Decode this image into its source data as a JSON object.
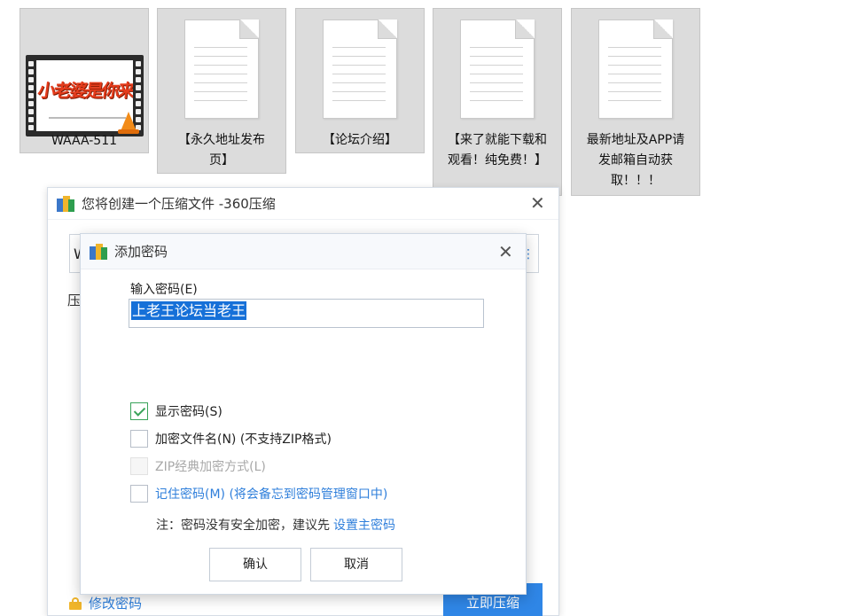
{
  "files": [
    {
      "label": "WAAA-511",
      "type": "video",
      "thumb_text": "小老婆是你来"
    },
    {
      "label": "【永久地址发布页】",
      "type": "document"
    },
    {
      "label": "【论坛介绍】",
      "type": "document"
    },
    {
      "label": "【来了就能下载和观看！纯免费！】",
      "type": "document"
    },
    {
      "label": "最新地址及APP请发邮箱自动获取！！！",
      "type": "document"
    }
  ],
  "compress_dialog": {
    "title": "您将创建一个压缩文件 -360压缩",
    "field_value_partial": "W",
    "label_partial": "压",
    "change_password_link": "修改密码",
    "compress_button": "立即压缩",
    "close_icon": "close-icon"
  },
  "password_dialog": {
    "title": "添加密码",
    "password_label": "输入密码(E)",
    "password_value": "上老王论坛当老王",
    "options": [
      {
        "label": "显示密码(S)",
        "checked": true,
        "disabled": false
      },
      {
        "label": "加密文件名(N) (不支持ZIP格式)",
        "checked": false,
        "disabled": false
      },
      {
        "label": "ZIP经典加密方式(L)",
        "checked": false,
        "disabled": true
      },
      {
        "label": "记住密码(M) (将会备忘到密码管理窗口中)",
        "checked": false,
        "disabled": false
      }
    ],
    "note_text": "注：密码没有安全加密，建议先",
    "note_link": "设置主密码",
    "ok_button": "确认",
    "cancel_button": "取消"
  },
  "colors": {
    "accent": "#2f7fdb",
    "check": "#3aa35a",
    "selection": "#1670d8"
  }
}
